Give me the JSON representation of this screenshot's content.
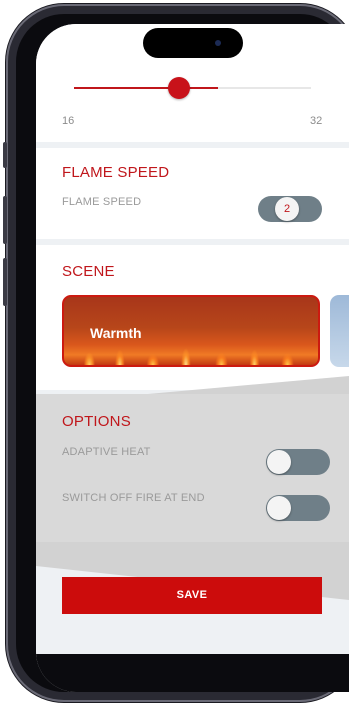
{
  "temperature": {
    "min_label": "16",
    "max_label": "32",
    "slider_fraction": 0.4
  },
  "flame_speed": {
    "title": "FLAME SPEED",
    "label": "FLAME SPEED",
    "toggle_value": "2"
  },
  "scene": {
    "title": "SCENE",
    "selected_scene": "Warmth"
  },
  "options": {
    "title": "OPTIONS",
    "items": [
      {
        "label": "ADAPTIVE HEAT",
        "enabled": false
      },
      {
        "label": "SWITCH OFF FIRE AT END",
        "enabled": false
      }
    ]
  },
  "save_label": "SAVE",
  "colors": {
    "accent": "#c0161b",
    "toggle_track": "#6f7f88",
    "button": "#cc0c0c"
  }
}
